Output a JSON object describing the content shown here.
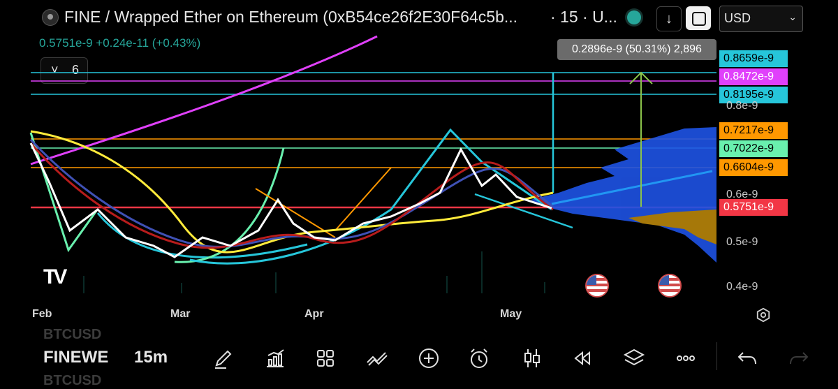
{
  "header": {
    "title": "FINE / Wrapped Ether on Ethereum (0xB54ce26f2E30F64c5b...",
    "interval_text": "· 15 · U...",
    "currency": "USD"
  },
  "price_info": "0.5751e-9  +0.24e-11 (+0.43%)",
  "indicator_toggle": {
    "chevron": "˅",
    "count": "6"
  },
  "measure_tooltip": "0.2896e-9 (50.31%) 2,896",
  "price_labels": [
    {
      "text": "0.8659e-9",
      "bg": "#26c6da",
      "fg": "#000000"
    },
    {
      "text": "0.8472e-9",
      "bg": "#e040fb",
      "fg": "#ffffff"
    },
    {
      "text": "0.8195e-9",
      "bg": "#26c6da",
      "fg": "#000000"
    },
    {
      "text": "0.7217e-9",
      "bg": "#ff9800",
      "fg": "#000000"
    },
    {
      "text": "0.7022e-9",
      "bg": "#69f0ae",
      "fg": "#000000"
    },
    {
      "text": "0.6604e-9",
      "bg": "#ff9800",
      "fg": "#000000"
    },
    {
      "text": "0.5751e-9",
      "bg": "#f23645",
      "fg": "#ffffff"
    }
  ],
  "axis_ticks": [
    "0.8e-9",
    "0.6e-9",
    "0.5e-9",
    "0.4e-9"
  ],
  "dates": [
    "Feb",
    "Mar",
    "Apr",
    "May"
  ],
  "toolbar": {
    "ghost_top": "BTCUSD",
    "symbol": "FINEWE",
    "interval": "15m",
    "ghost_bottom": "BTCUSD"
  },
  "colors": {
    "up": "#26a69a",
    "down": "#f23645",
    "accent_cyan": "#26c6da",
    "magenta": "#e040fb",
    "orange": "#ff9800",
    "green_line": "#69f0ae"
  }
}
